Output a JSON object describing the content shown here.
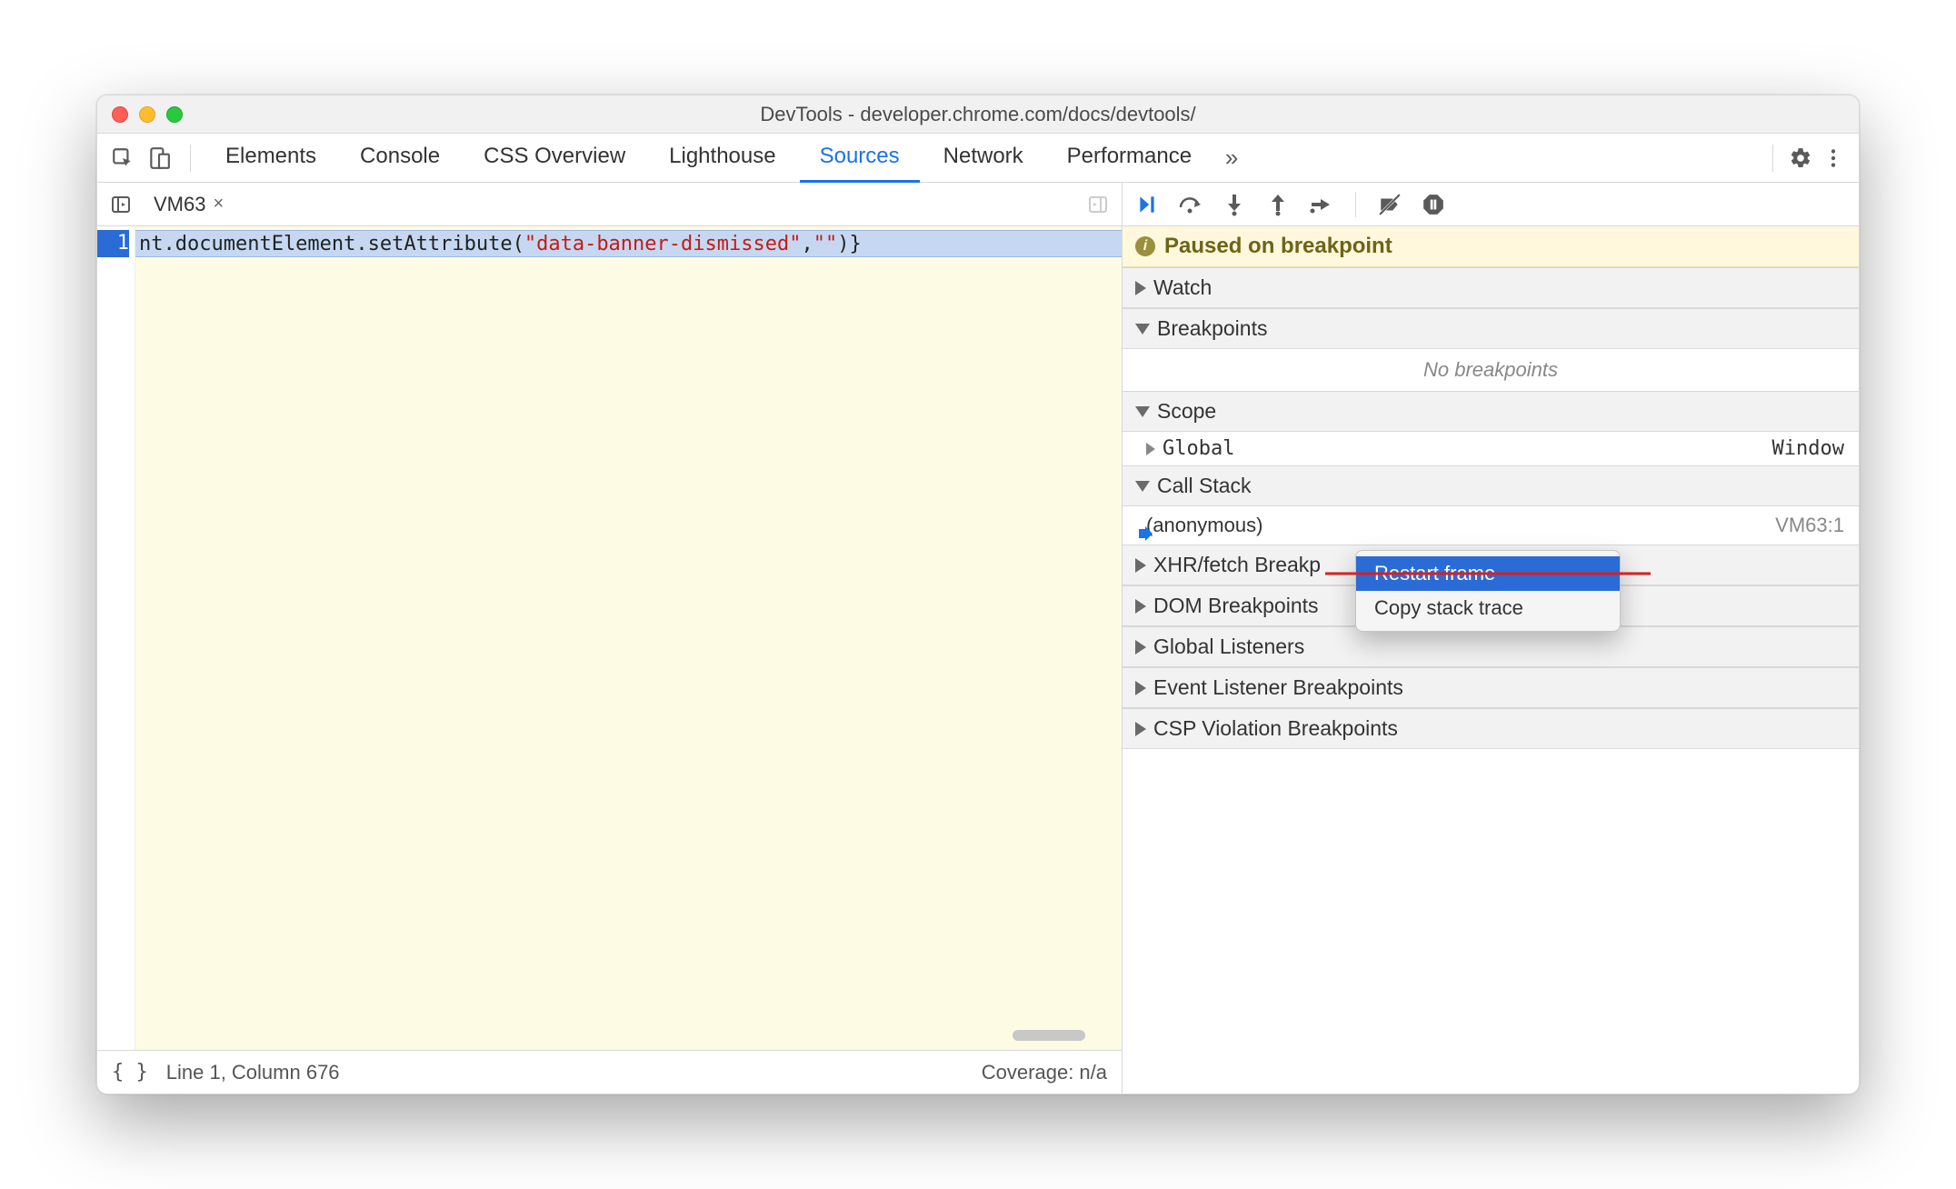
{
  "window": {
    "title": "DevTools - developer.chrome.com/docs/devtools/"
  },
  "topTabs": {
    "items": [
      "Elements",
      "Console",
      "CSS Overview",
      "Lighthouse",
      "Sources",
      "Network",
      "Performance"
    ],
    "activeIndex": 4
  },
  "fileTab": {
    "name": "VM63"
  },
  "code": {
    "line1_pre": "nt.documentElement.setAttribute(",
    "line1_str": "\"data-banner-dismissed\"",
    "line1_mid": ",",
    "line1_str2": "\"\"",
    "line1_post": ")}",
    "gutter1": "1"
  },
  "statusbar": {
    "pretty_icon": "{ }",
    "position": "Line 1, Column 676",
    "coverage": "Coverage: n/a"
  },
  "debugger": {
    "paused_label": "Paused on breakpoint"
  },
  "panels": {
    "watch": "Watch",
    "breakpoints": "Breakpoints",
    "no_breakpoints": "No breakpoints",
    "scope": "Scope",
    "global_label": "Global",
    "global_value": "Window",
    "callstack": "Call Stack",
    "anonymous": "(anonymous)",
    "anonymous_loc": "VM63:1",
    "xhr": "XHR/fetch Breakp",
    "dom": "DOM Breakpoints",
    "global_listeners": "Global Listeners",
    "event_listener": "Event Listener Breakpoints",
    "csp": "CSP Violation Breakpoints"
  },
  "contextMenu": {
    "item1": "Restart frame",
    "item2": "Copy stack trace"
  }
}
